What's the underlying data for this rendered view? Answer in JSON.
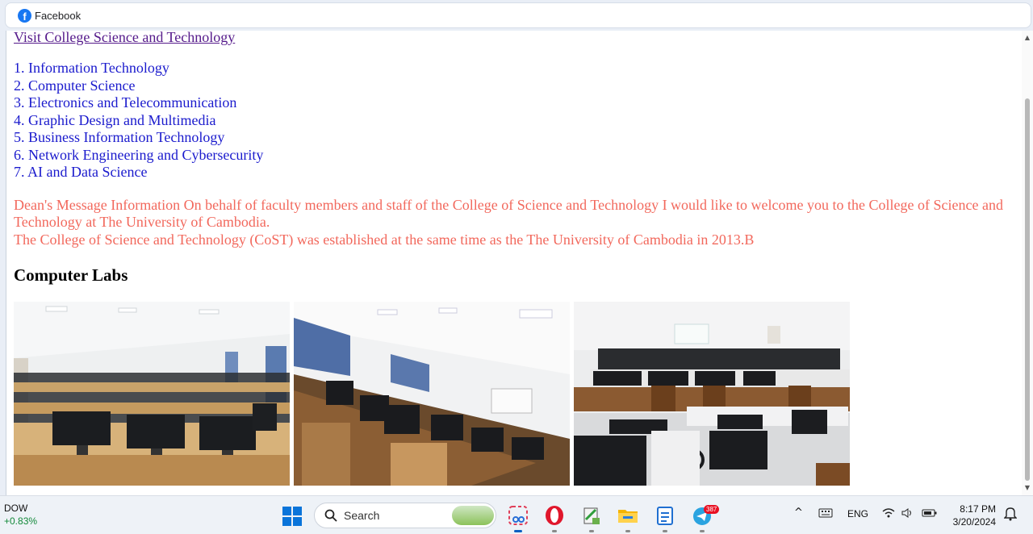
{
  "tab": {
    "label": "Facebook",
    "icon": "facebook-icon"
  },
  "page": {
    "visit_link": "Visit College Science and Technology",
    "programs": [
      "1. Information Technology",
      "2. Computer Science",
      "3. Electronics and Telecommunication",
      "4. Graphic Design and Multimedia",
      "5. Business Information Technology",
      "6. Network Engineering and Cybersecurity",
      "7. AI and Data Science"
    ],
    "dean_message_line1": "Dean's Message Information On behalf of faculty members and staff of the College of Science and Technology I would like to welcome you to the College of Science and Technology at The University of Cambodia.",
    "dean_message_line2": "The College of Science and Technology (CoST) was established at the same time as the The University of Cambodia in 2013.B",
    "labs_heading": "Computer Labs",
    "lab_photos": [
      "computer-lab-photo-1",
      "computer-lab-photo-2",
      "computer-lab-photo-3"
    ]
  },
  "colors": {
    "link_visited": "#551a8b",
    "program_blue": "#1a1acd",
    "dean_text": "#f2685c"
  },
  "taskbar": {
    "stock_name": "DOW",
    "stock_change": "+0.83%",
    "search_label": "Search",
    "telegram_badge": "387",
    "language": "ENG",
    "time": "8:17 PM",
    "date": "3/20/2024"
  }
}
